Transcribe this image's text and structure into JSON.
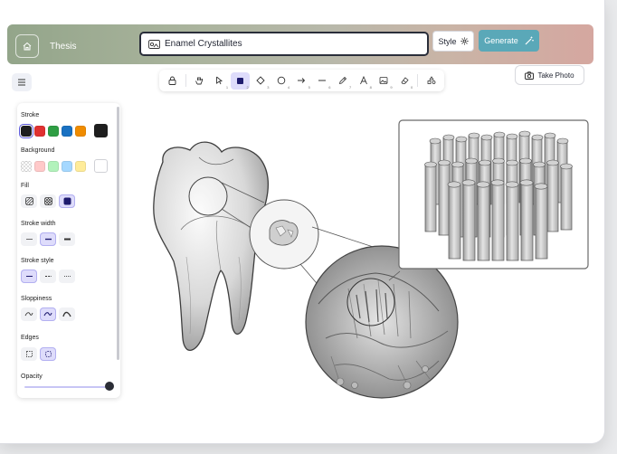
{
  "header": {
    "brand": "Thesis",
    "title_value": "Enamel Crystallites",
    "style_label": "Style",
    "generate_label": "Generate"
  },
  "toolbar": {
    "tools": [
      {
        "name": "lock-tool",
        "num": ""
      },
      {
        "name": "hand-tool",
        "num": ""
      },
      {
        "name": "select-tool",
        "num": "1"
      },
      {
        "name": "rectangle-tool",
        "num": "2",
        "active": true
      },
      {
        "name": "diamond-tool",
        "num": "3"
      },
      {
        "name": "ellipse-tool",
        "num": "4"
      },
      {
        "name": "arrow-tool",
        "num": "5"
      },
      {
        "name": "line-tool",
        "num": "6"
      },
      {
        "name": "pencil-tool",
        "num": "7"
      },
      {
        "name": "text-tool",
        "num": "8"
      },
      {
        "name": "image-tool",
        "num": "9"
      },
      {
        "name": "eraser-tool",
        "num": "0"
      },
      {
        "name": "library-tool",
        "num": ""
      }
    ],
    "photo_label": "Take Photo"
  },
  "panel": {
    "stroke_label": "Stroke",
    "stroke_colors": [
      "#1e1e1e",
      "#e03131",
      "#2f9e44",
      "#1971c2",
      "#f08c00"
    ],
    "stroke_current": "#1e1e1e",
    "background_label": "Background",
    "background_colors": [
      "transparent",
      "#ffc9c9",
      "#b2f2bb",
      "#a5d8ff",
      "#ffec99"
    ],
    "background_current": "#ffffff",
    "fill_label": "Fill",
    "stroke_width_label": "Stroke width",
    "stroke_style_label": "Stroke style",
    "sloppiness_label": "Sloppiness",
    "edges_label": "Edges",
    "opacity_label": "Opacity",
    "opacity_value": 1.0
  }
}
